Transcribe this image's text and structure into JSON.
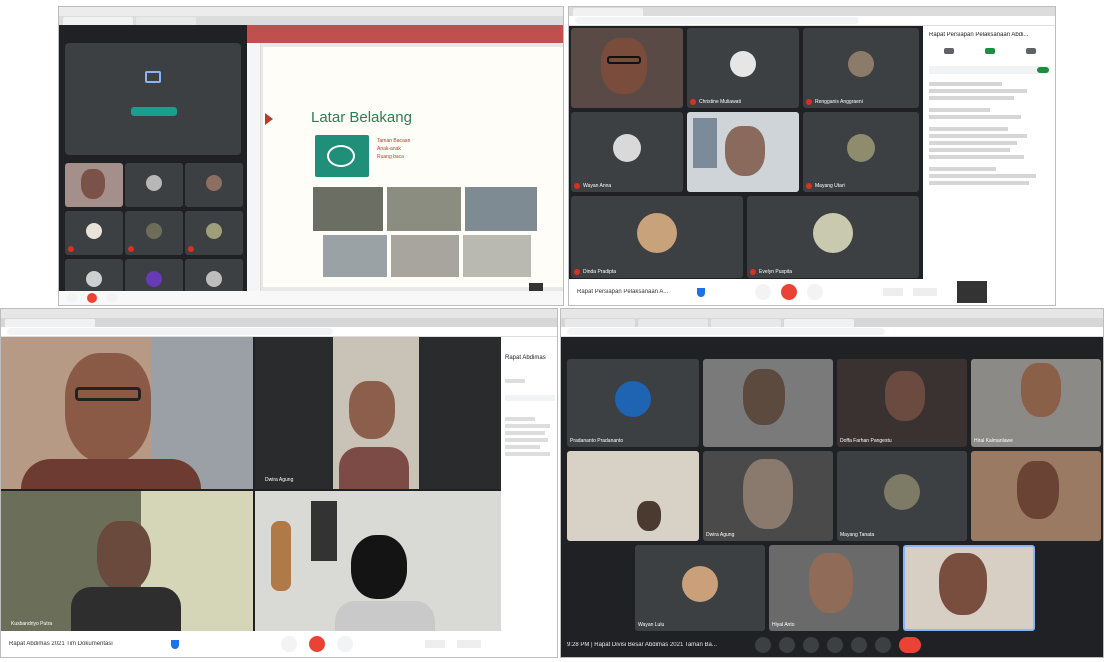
{
  "slide": {
    "title": "Latar Belakang",
    "bullets": [
      "Taman Bacaan",
      "Anak-anak ",
      "Ruang baca "
    ]
  },
  "top_right": {
    "panel_title": "Rapat Persiapan Pelaksanaan Abdi...",
    "meeting_bar_title": "Rapat Persiapan Pelaksanaan A...",
    "participants": [
      {
        "name": "Wayan Anna"
      },
      {
        "name": "Christine Muliawati"
      },
      {
        "name": "Rengganis Anggraeni"
      },
      {
        "name": "Mayang Utari"
      },
      {
        "name": "Dinda Pradipta"
      },
      {
        "name": "Evelyn Puspita"
      }
    ]
  },
  "bottom_left": {
    "panel_title": "Rapat Abdimas",
    "meeting_bar_title": "Rapat Abdimas 2021 Tim Dokumentasi",
    "names": [
      "Dwira Agung",
      "Kusbandriyo Putra"
    ]
  },
  "bottom_right": {
    "meeting_bar_text": "9:28 PM | Rapat Divisi Besar Abdimas 2021 Taman Ba...",
    "names": [
      "Pradananto Pradananto",
      "",
      "Doffa Farhan Pangestu",
      "Hiral Kalmanlawe",
      "",
      "Dwira Agung",
      "Mayang Tanata",
      "",
      "Wayan Lulu",
      "Hiyal Anto",
      ""
    ]
  }
}
